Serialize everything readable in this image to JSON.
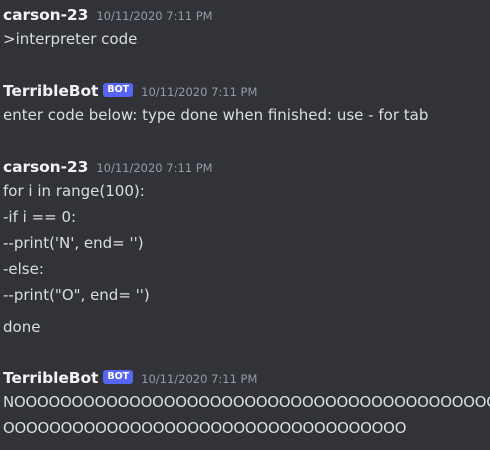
{
  "messages": [
    {
      "author": "carson-23",
      "bot": false,
      "timestamp": "10/11/2020 7:11 PM",
      "lines": [
        ">interpreter code"
      ]
    },
    {
      "author": "TerribleBot",
      "bot": true,
      "bot_tag": "BOT",
      "timestamp": "10/11/2020 7:11 PM",
      "lines": [
        "enter code below: type done when finished: use - for tab"
      ]
    },
    {
      "author": "carson-23",
      "bot": false,
      "timestamp": "10/11/2020 7:11 PM",
      "lines": [
        "for i in range(100):",
        "-if i == 0:",
        "--print('N', end= '')",
        "-else:",
        "--print(\"O\", end= '')",
        "done"
      ]
    },
    {
      "author": "TerribleBot",
      "bot": true,
      "bot_tag": "BOT",
      "timestamp": "10/11/2020 7:11 PM",
      "lines": [
        "NOOOOOOOOOOOOOOOOOOOOOOOOOOOOOOOOOOOOOOOOOO",
        "OOOOOOOOOOOOOOOOOOOOOOOOOOOOOOOOOOO"
      ]
    }
  ]
}
